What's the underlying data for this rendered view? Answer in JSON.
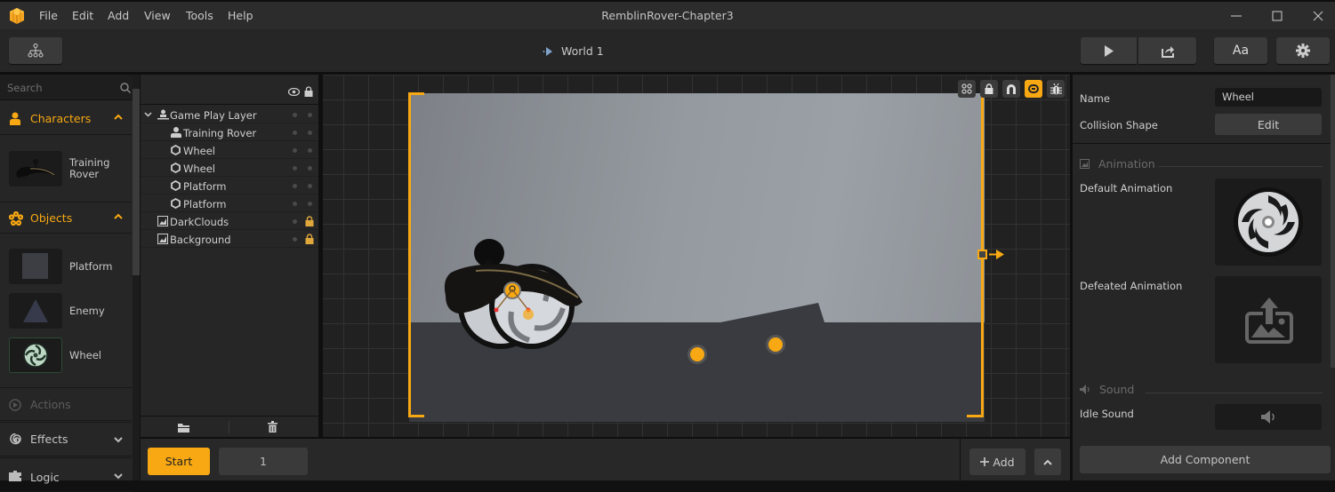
{
  "app": {
    "title": "RemblinRover-Chapter3",
    "menu": [
      "File",
      "Edit",
      "Add",
      "View",
      "Tools",
      "Help"
    ]
  },
  "toolbar": {
    "world_label": "World 1",
    "font_button_label": "Aa"
  },
  "left_panel": {
    "search_placeholder": "Search",
    "sections": [
      {
        "label": "Characters",
        "icon": "person-icon",
        "expanded": true,
        "active": true
      },
      {
        "label": "Objects",
        "icon": "flower-icon",
        "expanded": true,
        "active": true
      },
      {
        "label": "Actions",
        "icon": "play-circle-icon",
        "expanded": false,
        "active": false
      },
      {
        "label": "Effects",
        "icon": "spiral-icon",
        "expanded": false,
        "active": false
      },
      {
        "label": "Logic",
        "icon": "puzzle-icon",
        "expanded": false,
        "active": false
      }
    ],
    "characters": [
      {
        "label": "Training\nRover",
        "line1": "Training",
        "line2": "Rover"
      }
    ],
    "objects": [
      {
        "label": "Platform"
      },
      {
        "label": "Enemy"
      },
      {
        "label": "Wheel"
      }
    ]
  },
  "hierarchy": {
    "rows": [
      {
        "label": "Game Play Layer",
        "icon": "layer-person-icon",
        "locked": false,
        "expanded": true
      },
      {
        "label": "Training Rover",
        "icon": "person-icon",
        "locked": false
      },
      {
        "label": "Wheel",
        "icon": "hexagon-icon",
        "locked": false
      },
      {
        "label": "Wheel",
        "icon": "hexagon-icon",
        "locked": false
      },
      {
        "label": "Platform",
        "icon": "hexagon-icon",
        "locked": false
      },
      {
        "label": "Platform",
        "icon": "hexagon-icon",
        "locked": false
      },
      {
        "label": "DarkClouds",
        "icon": "image-icon",
        "locked": true
      },
      {
        "label": "Background",
        "icon": "image-icon",
        "locked": true
      }
    ]
  },
  "canvas_tools": [
    {
      "name": "group-tool",
      "active": false
    },
    {
      "name": "lock-tool",
      "active": false
    },
    {
      "name": "magnet-tool",
      "active": false
    },
    {
      "name": "link-tool",
      "active": true
    },
    {
      "name": "debug-tool",
      "active": false
    }
  ],
  "bottom_bar": {
    "start_label": "Start",
    "frame_value": "1",
    "add_label": "Add"
  },
  "properties": {
    "name_label": "Name",
    "name_value": "Wheel",
    "collision_label": "Collision Shape",
    "collision_button": "Edit",
    "animation_section": "Animation",
    "default_animation_label": "Default Animation",
    "defeated_animation_label": "Defeated Animation",
    "sound_section": "Sound",
    "idle_sound_label": "Idle Sound",
    "add_component_label": "Add Component"
  },
  "colors": {
    "accent": "#f7a812",
    "background": "#262626",
    "panel_dark": "#1b1b1b"
  }
}
